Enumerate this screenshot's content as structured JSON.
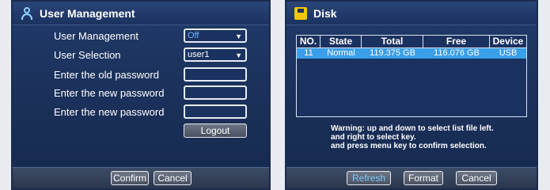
{
  "left_panel": {
    "title": "User Management",
    "icon": "user-icon",
    "rows": {
      "user_management": {
        "label": "User Management",
        "value": "Off"
      },
      "user_selection": {
        "label": "User Selection",
        "value": "user1"
      },
      "old_password": {
        "label": "Enter the old password",
        "value": ""
      },
      "new_password": {
        "label": "Enter the new password",
        "value": ""
      },
      "confirm_password": {
        "label": "Enter the new password",
        "value": ""
      }
    },
    "logout_label": "Logout",
    "confirm_label": "Confirm",
    "cancel_label": "Cancel"
  },
  "right_panel": {
    "title": "Disk",
    "icon": "disk-icon",
    "table": {
      "headers": [
        "NO.",
        "State",
        "Total",
        "Free",
        "Device"
      ],
      "rows": [
        [
          "11",
          "Normal",
          "119.375 GB",
          "116.076 GB",
          "USB"
        ]
      ]
    },
    "warning": [
      "Warning: up and down to select list file left.",
      "and right to select key.",
      "and press menu key to confirm selection."
    ],
    "refresh_label": "Refresh",
    "format_label": "Format",
    "cancel_label": "Cancel"
  },
  "colors": {
    "panel_bg": "#1b3260",
    "selected_row": "#3a9ee8",
    "active_button_text": "#7cc8ff",
    "off_value": "#6fb6ff"
  }
}
